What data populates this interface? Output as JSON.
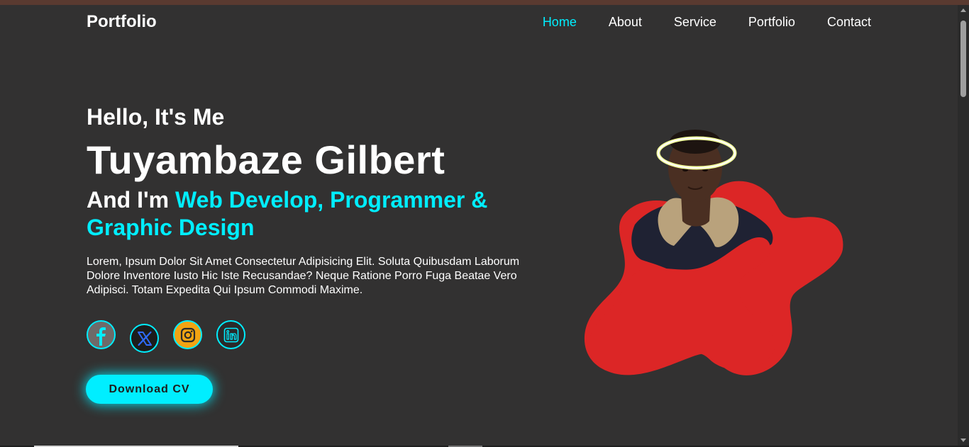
{
  "header": {
    "brand": "Portfolio",
    "nav": [
      {
        "label": "Home",
        "active": true
      },
      {
        "label": "About",
        "active": false
      },
      {
        "label": "Service",
        "active": false
      },
      {
        "label": "Portfolio",
        "active": false
      },
      {
        "label": "Contact",
        "active": false
      }
    ]
  },
  "hero": {
    "greeting": "Hello, It's Me",
    "name": "Tuyambaze Gilbert",
    "role_prefix": "And I'm",
    "role_highlight": "Web Develop, Programmer & Graphic Design",
    "description": "Lorem, Ipsum Dolor Sit Amet Consectetur Adipisicing Elit. Soluta Quibusdam Laborum Dolore Inventore Iusto Hic Iste Recusandae? Neque Ratione Porro Fuga Beatae Vero Adipisci. Totam Expedita Qui Ipsum Commodi Maxime.",
    "social": [
      {
        "icon": "facebook-icon"
      },
      {
        "icon": "x-icon"
      },
      {
        "icon": "instagram-icon"
      },
      {
        "icon": "linkedin-icon"
      }
    ],
    "cv_button": "Download CV"
  },
  "colors": {
    "accent": "#00eeff",
    "background": "#323131",
    "blob": "#dc2626"
  }
}
